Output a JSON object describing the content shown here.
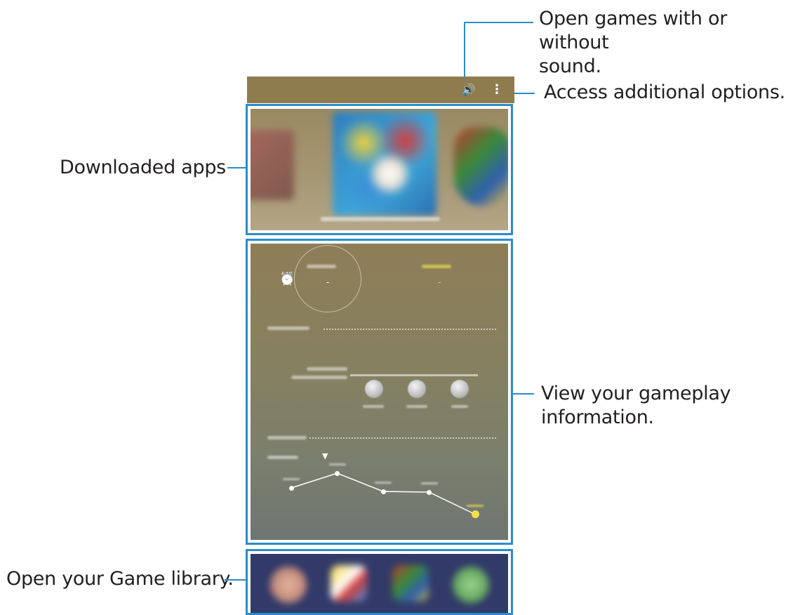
{
  "callouts": {
    "sound_line1": "Open games with or without",
    "sound_line2": "sound.",
    "options": "Access additional options.",
    "downloaded": "Downloaded apps",
    "gameplay_line1": "View your gameplay",
    "gameplay_line2": "information.",
    "library": "Open your Game library."
  },
  "topbar": {
    "sound_icon": "volume-icon",
    "menu_icon": "more-options-icon",
    "sound_glyph": "🔊",
    "menu_glyph": "⋮"
  },
  "info": {
    "alarm_icon": "alarm-clock-icon",
    "alarm_glyph": "⏰",
    "stat_left_value": "-",
    "stat_right_value": "-",
    "dropdown_icon": "caret-down-icon",
    "dropdown_glyph": "▼"
  },
  "library": {
    "expand_icon": "chevron-up-icon",
    "expand_glyph": "^"
  },
  "colors": {
    "callout_line": "#2a8dc9",
    "topbar": "#8e7b4e",
    "library_bg": "#323a69",
    "highlight_point": "#f2e04a"
  },
  "chart_data": {
    "type": "line",
    "points": [
      0.4,
      0.82,
      0.3,
      0.28,
      -0.35
    ]
  }
}
